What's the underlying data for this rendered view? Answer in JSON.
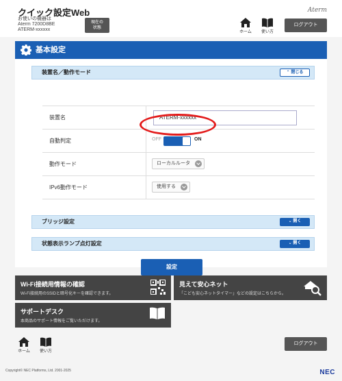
{
  "header": {
    "title": "クイック設定Web",
    "device_info_line1": "お使いの機器は",
    "device_info_line2": "Aterm 7200D8BE",
    "device_info_line3": "ATERM-xxxxxx",
    "status_button_line1": "現在の",
    "status_button_line2": "状態",
    "brand": "Aterm",
    "home_label": "ホーム",
    "help_label": "使い方",
    "logout_label": "ログアウト"
  },
  "panel": {
    "title": "基本設定",
    "section_device_mode": {
      "label": "装置名／動作モード",
      "toggle_label": "閉じる"
    },
    "rows": {
      "device_name_label": "装置名",
      "device_name_value": "ATERM-xxxxxx",
      "auto_detect_label": "自動判定",
      "auto_detect_off": "OFF",
      "auto_detect_on": "ON",
      "mode_label": "動作モード",
      "mode_value": "ローカルルータ",
      "ipv6_label": "IPv6動作モード",
      "ipv6_value": "使用する"
    },
    "section_bridge": {
      "label": "ブリッジ設定",
      "toggle_label": "開く"
    },
    "section_lamp": {
      "label": "状態表示ランプ点灯設定",
      "toggle_label": "開く"
    },
    "submit_label": "設定"
  },
  "tiles": {
    "wifi": {
      "title": "Wi-Fi接続用情報の確認",
      "desc": "Wi-Fi接続用のSSIDと暗号化キーを確認できます。"
    },
    "safety": {
      "title": "見えて安心ネット",
      "desc": "「こども安心ネットタイマー」などの設定はこちらから。"
    },
    "support": {
      "title": "サポートデスク",
      "desc": "本商品のサポート情報をご覧いただけます。"
    }
  },
  "footer": {
    "home_label": "ホーム",
    "help_label": "使い方",
    "logout_label": "ログアウト",
    "copyright": "Copyright© NEC Platforms, Ltd. 2001-2025",
    "nec_logo": "NEC"
  },
  "colors": {
    "accent": "#1a5fb4",
    "section_bg": "#d4e8f7",
    "tile_bg": "#444444",
    "highlight": "#e31b1b"
  }
}
